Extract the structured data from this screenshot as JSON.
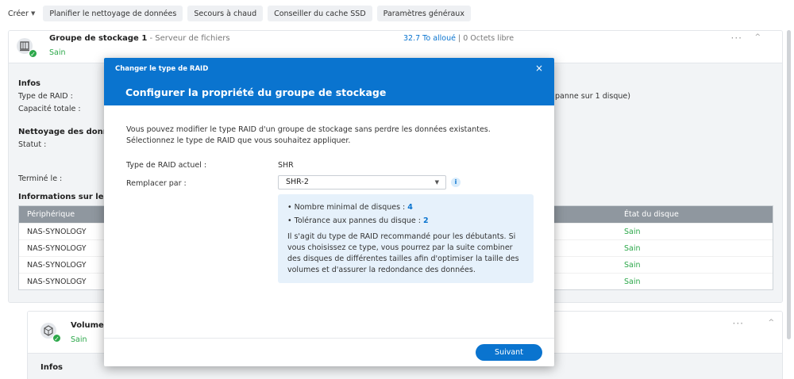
{
  "toolbar": {
    "create": "Créer",
    "schedule_scrub": "Planifier le nettoyage de données",
    "hot_spare": "Secours à chaud",
    "ssd_advisor": "Conseiller du cache SSD",
    "general_settings": "Paramètres généraux"
  },
  "pool": {
    "title": "Groupe de stockage 1",
    "subtitle": " - Serveur de fichiers",
    "status": "Sain",
    "allocated": "32.7 To alloué",
    "free": " | 0 Octets libre",
    "more": "···",
    "collapse": "^",
    "info_title": "Infos",
    "raid_type_label": "Type de RAID :",
    "capacity_label": "Capacité totale :",
    "raid_tail": "panne sur 1 disque)",
    "scrub_title": "Nettoyage des donné",
    "status_label": "Statut :",
    "finished_label": "Terminé le :",
    "drive_info_title": "Informations sur le d",
    "table": {
      "col_device": "Périphérique",
      "col_state": "État du disque",
      "rows": [
        {
          "device": "NAS-SYNOLOGY",
          "state": "Sain"
        },
        {
          "device": "NAS-SYNOLOGY",
          "state": "Sain"
        },
        {
          "device": "NAS-SYNOLOGY",
          "state": "Sain"
        },
        {
          "device": "NAS-SYNOLOGY",
          "state": "Sain"
        }
      ]
    }
  },
  "volume": {
    "title": "Volume",
    "status": "Sain",
    "info_title": "Infos",
    "more": "···",
    "collapse": "^"
  },
  "modal": {
    "small_title": "Changer le type de RAID",
    "title": "Configurer la propriété du groupe de stockage",
    "close": "×",
    "description": "Vous pouvez modifier le type RAID d'un groupe de stockage sans perdre les données existantes. Sélectionnez le type de RAID que vous souhaitez appliquer.",
    "current_label": "Type de RAID actuel :",
    "current_value": "SHR",
    "replace_label": "Remplacer par :",
    "replace_value": "SHR-2",
    "info_icon": "i",
    "min_disks_label": "Nombre minimal de disques : ",
    "min_disks_value": "4",
    "fault_tolerance_label": "Tolérance aux pannes du disque : ",
    "fault_tolerance_value": "2",
    "info_text": "Il s'agit du type de RAID recommandé pour les débutants. Si vous choisissez ce type, vous pourrez par la suite combiner des disques de différentes tailles afin d'optimiser la taille des volumes et d'assurer la redondance des données.",
    "next_button": "Suivant"
  },
  "colors": {
    "accent": "#0a74cf",
    "healthy": "#2ca84a"
  }
}
